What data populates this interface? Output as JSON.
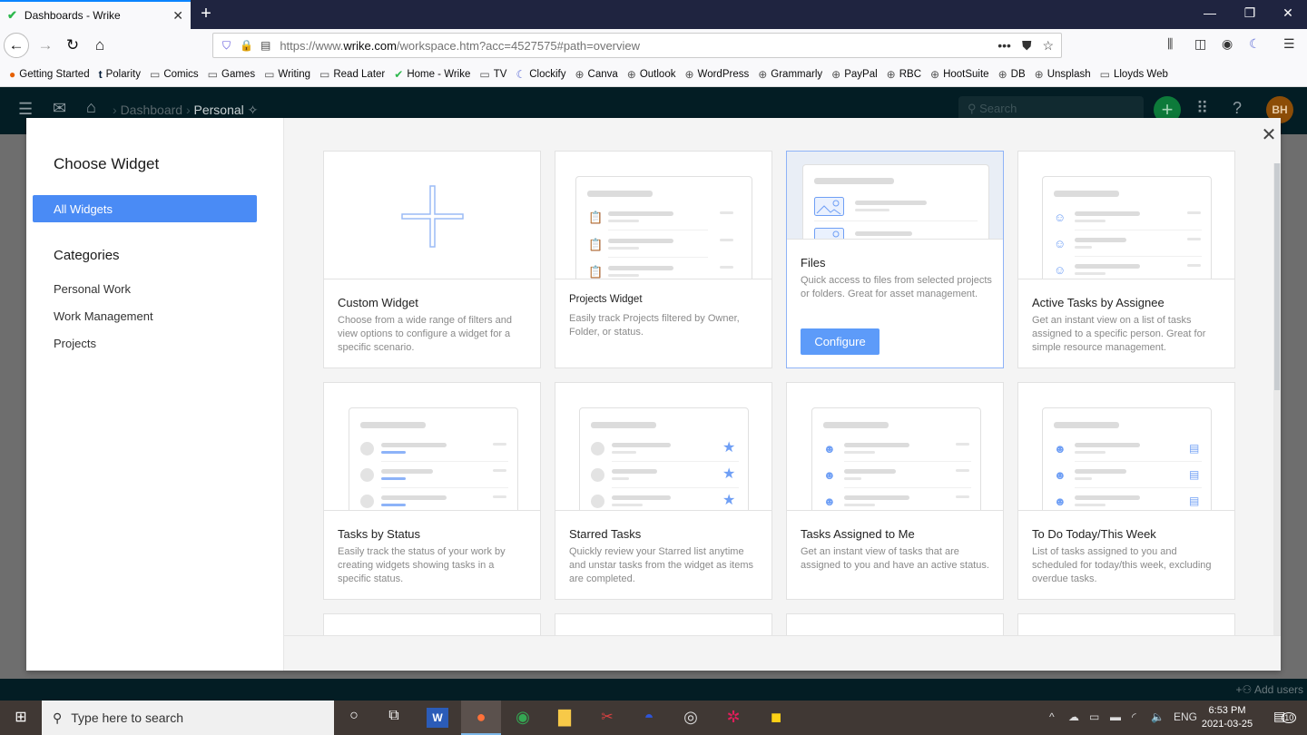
{
  "browser": {
    "tab_title": "Dashboards - Wrike",
    "url_prefix": "https://www.",
    "url_domain": "wrike.com",
    "url_suffix": "/workspace.htm?acc=4527575#path=overview",
    "bookmarks": [
      "Getting Started",
      "Polarity",
      "Comics",
      "Games",
      "Writing",
      "Read Later",
      "Home - Wrike",
      "TV",
      "Clockify",
      "Canva",
      "Outlook",
      "WordPress",
      "Grammarly",
      "PayPal",
      "RBC",
      "HootSuite",
      "DB",
      "Unsplash",
      "Lloyds Web"
    ]
  },
  "app": {
    "breadcrumb": [
      "Dashboard",
      "Personal"
    ],
    "search_placeholder": "Search",
    "avatar_initials": "BH",
    "add_users": "Add users",
    "accent_color": "#4a8bf5",
    "header_color": "#031d24"
  },
  "modal": {
    "title": "Choose Widget",
    "all_widgets": "All Widgets",
    "categories_heading": "Categories",
    "categories": [
      "Personal Work",
      "Work Management",
      "Projects"
    ],
    "configure_label": "Configure",
    "widgets": [
      {
        "title": "Custom Widget",
        "desc": "Choose from a wide range of filters and view options to configure a widget for a specific scenario."
      },
      {
        "title": "Projects Widget",
        "desc": "Easily track Projects filtered by Owner, Folder, or status."
      },
      {
        "title": "Files",
        "desc": "Quick access to files from selected projects or folders. Great for asset management."
      },
      {
        "title": "Active Tasks by Assignee",
        "desc": "Get an instant view on a list of tasks assigned to a specific person. Great for simple resource management."
      },
      {
        "title": "Tasks by Status",
        "desc": "Easily track the status of your work by creating widgets showing tasks in a specific status."
      },
      {
        "title": "Starred Tasks",
        "desc": "Quickly review your Starred list anytime and unstar tasks from the widget as items are completed."
      },
      {
        "title": "Tasks Assigned to Me",
        "desc": "Get an instant view of tasks that are assigned to you and have an active status."
      },
      {
        "title": "To Do Today/This Week",
        "desc": "List of tasks assigned to you and scheduled for today/this week, excluding overdue tasks."
      }
    ]
  },
  "taskbar": {
    "search_placeholder": "Type here to search",
    "language": "ENG",
    "time": "6:53 PM",
    "date": "2021-03-25",
    "notifications": "10"
  }
}
